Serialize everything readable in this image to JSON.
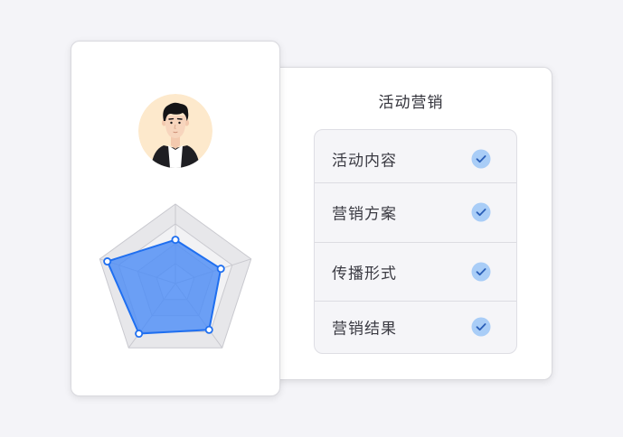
{
  "panel": {
    "title": "活动营销"
  },
  "checklist": {
    "items": [
      {
        "label": "活动内容",
        "checked": true,
        "icon": "check-circle-icon"
      },
      {
        "label": "营销方案",
        "checked": true,
        "icon": "check-circle-icon"
      },
      {
        "label": "传播形式",
        "checked": true,
        "icon": "check-circle-icon"
      },
      {
        "label": "营销结果",
        "checked": true,
        "icon": "check-circle-icon"
      }
    ]
  },
  "profile": {
    "avatar_icon": "person-avatar-icon"
  },
  "radar": {
    "axes": 5,
    "scale_levels": 4,
    "values": [
      0.55,
      0.6,
      0.72,
      0.78,
      0.9
    ]
  },
  "colors": {
    "accent": "#1f6ff0",
    "accent_fill": "#4d8cf5",
    "check_bg": "#a9cdf7",
    "check_mark": "#2b5fb8",
    "avatar_bg": "#fde9cc",
    "background": "#f4f4f8",
    "card": "#ffffff"
  }
}
